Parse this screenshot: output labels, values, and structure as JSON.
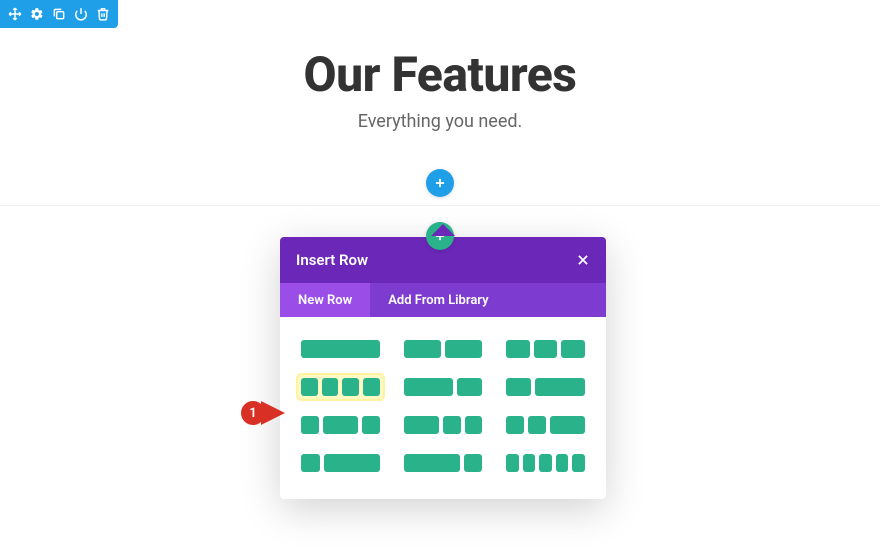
{
  "hero": {
    "title": "Our Features",
    "subtitle": "Everything you need."
  },
  "popover": {
    "title": "Insert Row",
    "tabs": {
      "new_row": "New Row",
      "add_library": "Add From Library"
    }
  },
  "annotation": {
    "num": "1"
  },
  "layouts": [
    {
      "cols": [
        1
      ]
    },
    {
      "cols": [
        1,
        1
      ]
    },
    {
      "cols": [
        1,
        1,
        1
      ]
    },
    {
      "cols": [
        1,
        1,
        1,
        1
      ],
      "highlight": true
    },
    {
      "cols": [
        2,
        1
      ]
    },
    {
      "cols": [
        1,
        2
      ]
    },
    {
      "cols": [
        1,
        2,
        1
      ]
    },
    {
      "cols": [
        2,
        1,
        1
      ]
    },
    {
      "cols": [
        1,
        1,
        2
      ]
    },
    {
      "cols": [
        1,
        3
      ]
    },
    {
      "cols": [
        3,
        1
      ]
    },
    {
      "cols": [
        1,
        1,
        1,
        1,
        1
      ]
    }
  ]
}
